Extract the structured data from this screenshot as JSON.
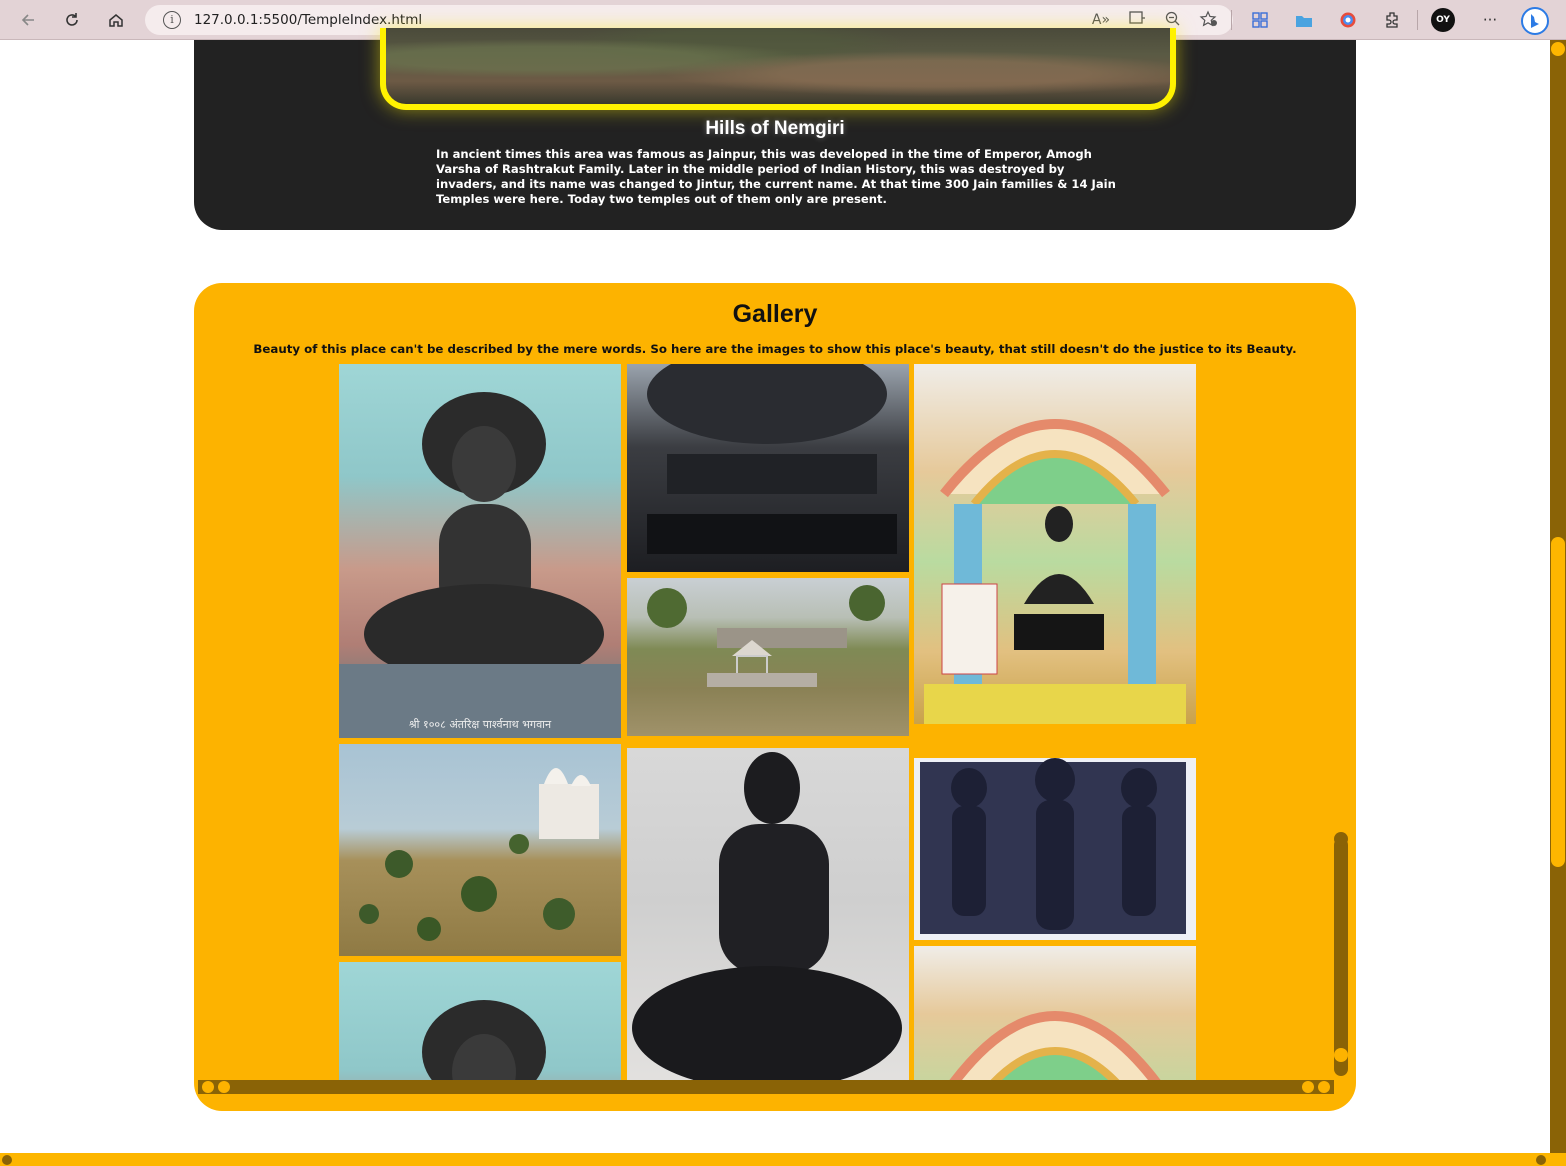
{
  "browser": {
    "url": "127.0.0.1:5500/TempleIndex.html",
    "profile_initials": "OY"
  },
  "hills": {
    "title": "Hills of Nemgiri",
    "description": "In ancient times this area was famous as Jainpur, this was developed in the time of Emperor, Amogh Varsha of Rashtrakut Family. Later in the middle period of Indian History, this was destroyed by invaders, and its name was changed to Jintur, the current name. At that time 300 Jain families & 14 Jain Temples were here. Today two temples out of them only are present."
  },
  "gallery": {
    "title": "Gallery",
    "description": "Beauty of this place can't be described by the mere words. So here are the images to show this place's beauty, that still doesn't do the justice to its Beauty.",
    "photos": [
      {
        "name": "parshvanath-statue-photo",
        "caption": "श्री १००८ अंतरिक्ष पार्श्वनाथ भगवान"
      },
      {
        "name": "statue-base-photo",
        "caption": ""
      },
      {
        "name": "shrine-idol-photo",
        "caption": ""
      },
      {
        "name": "hill-pavilion-photo",
        "caption": ""
      },
      {
        "name": "hill-temple-photo",
        "caption": ""
      },
      {
        "name": "seated-black-statue-photo",
        "caption": ""
      },
      {
        "name": "three-tirthankara-relief-photo",
        "caption": ""
      },
      {
        "name": "parshvanath-statue-photo-2",
        "caption": ""
      },
      {
        "name": "shrine-idol-photo-2",
        "caption": ""
      }
    ]
  },
  "colors": {
    "accent": "#fdb300",
    "dark": "#222222",
    "scroll_dark": "#8a6306",
    "glow": "#fff200"
  }
}
